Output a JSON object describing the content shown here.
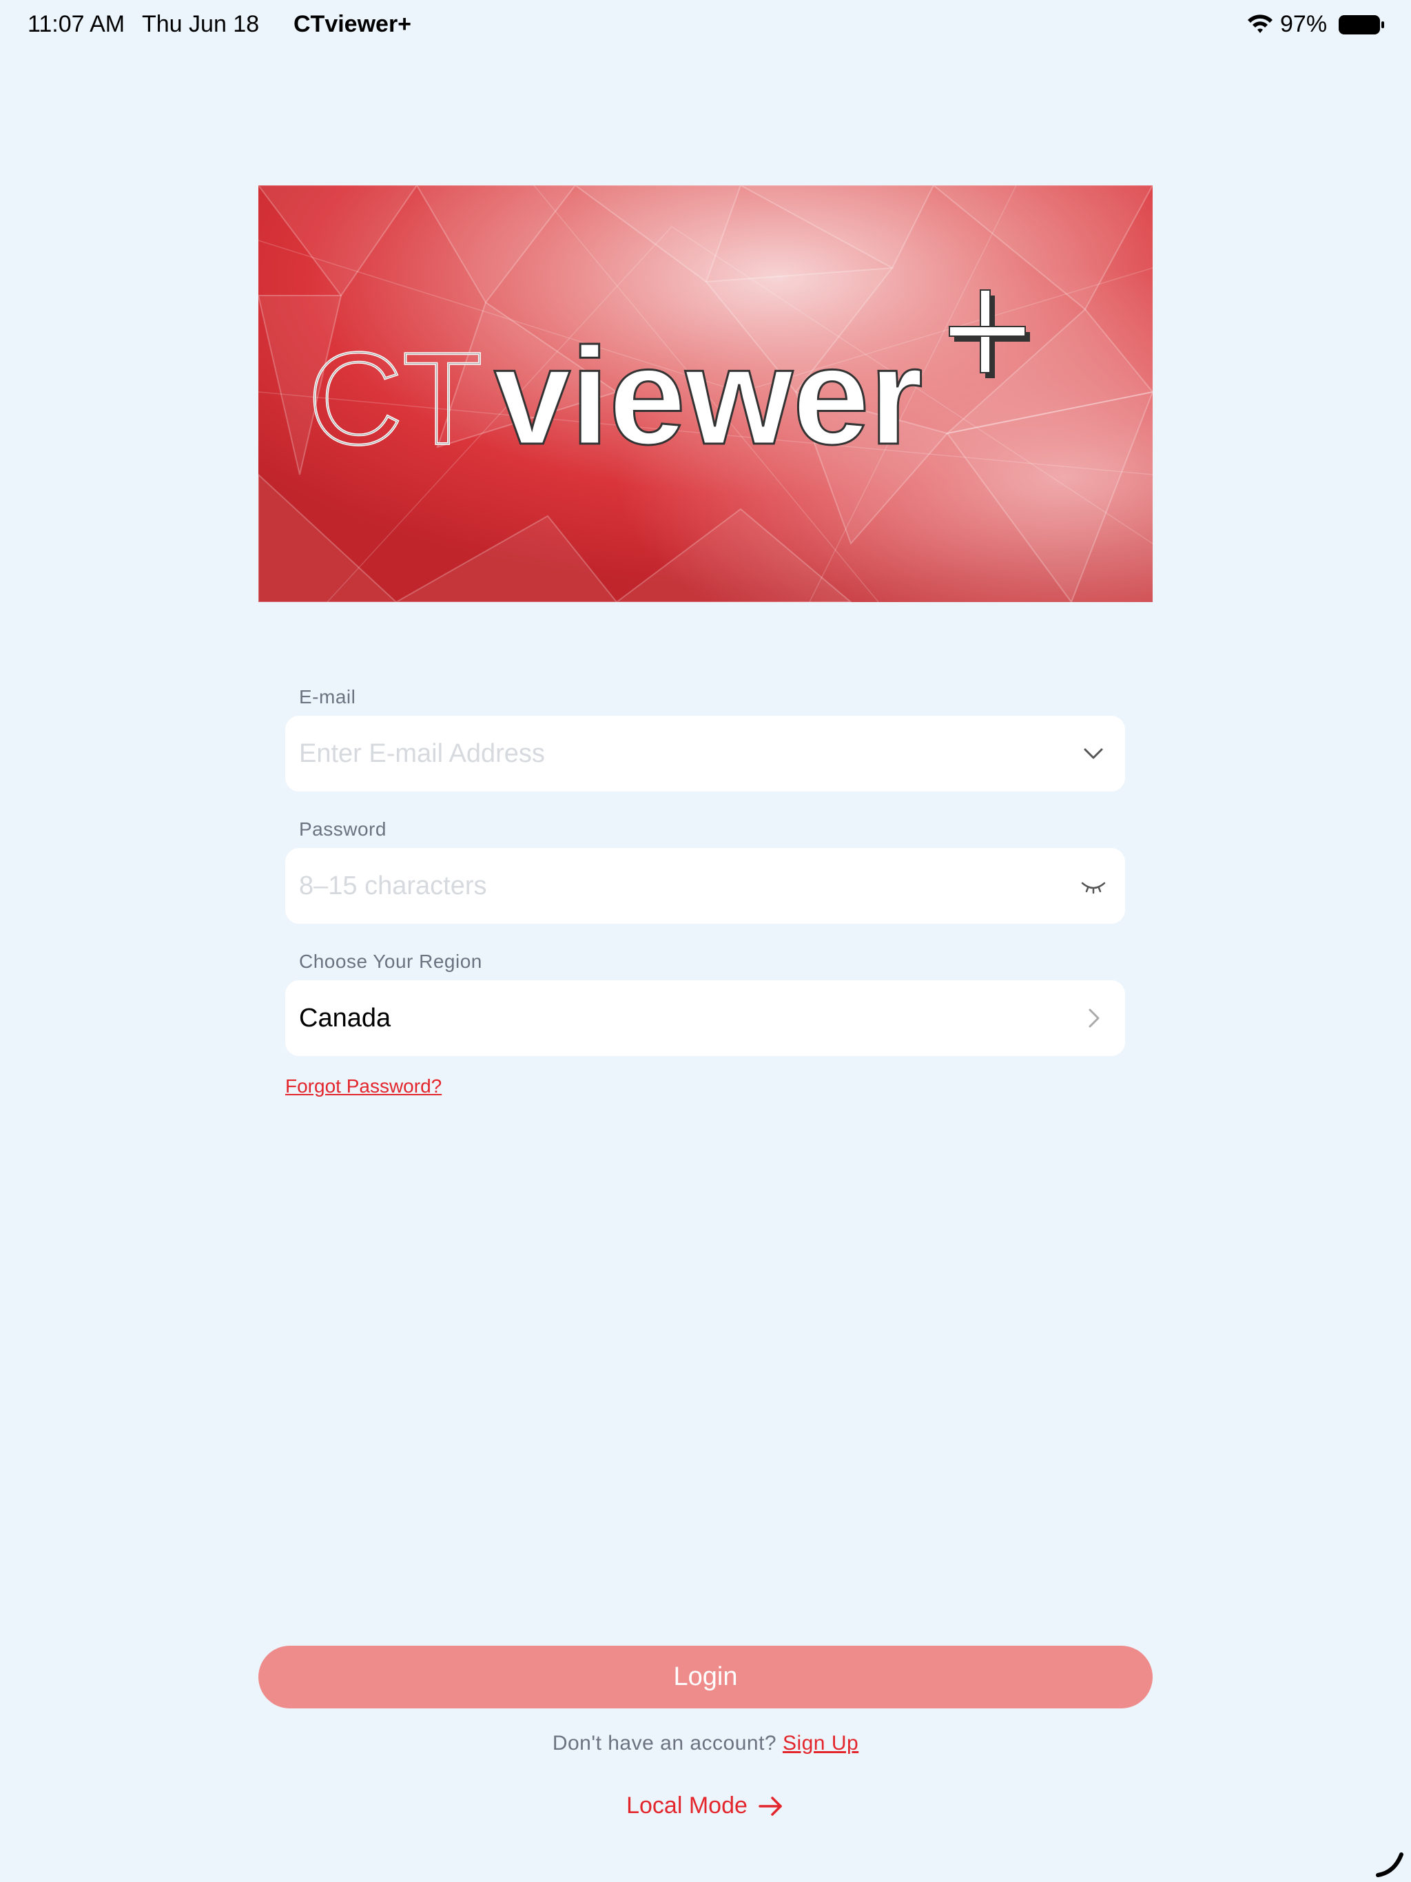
{
  "status_bar": {
    "time": "11:07 AM",
    "date": "Thu Jun 18",
    "app_name": "CTviewer+",
    "battery_percent": "97%",
    "wifi_icon": "wifi-icon",
    "battery_icon": "battery-icon"
  },
  "banner": {
    "logo_text_light": "CT",
    "logo_text_bold": "viewer",
    "logo_plus": "+"
  },
  "form": {
    "email": {
      "label": "E-mail",
      "placeholder": "Enter E-mail Address",
      "value": "",
      "icon": "chevron-down-icon"
    },
    "password": {
      "label": "Password",
      "placeholder": "8–15 characters",
      "value": "",
      "icon": "eye-closed-icon"
    },
    "region": {
      "label": "Choose Your Region",
      "value": "Canada",
      "icon": "chevron-right-icon"
    },
    "forgot_password": "Forgot Password?"
  },
  "actions": {
    "login_label": "Login",
    "signup_prompt": "Don't have an account? ",
    "signup_link": "Sign Up",
    "local_mode_label": "Local Mode",
    "local_mode_icon": "arrow-right-icon"
  },
  "colors": {
    "background": "#ecf4fc",
    "accent": "#e3262b",
    "login_button": "#ee8c8b",
    "banner_red": "#d7313a"
  }
}
